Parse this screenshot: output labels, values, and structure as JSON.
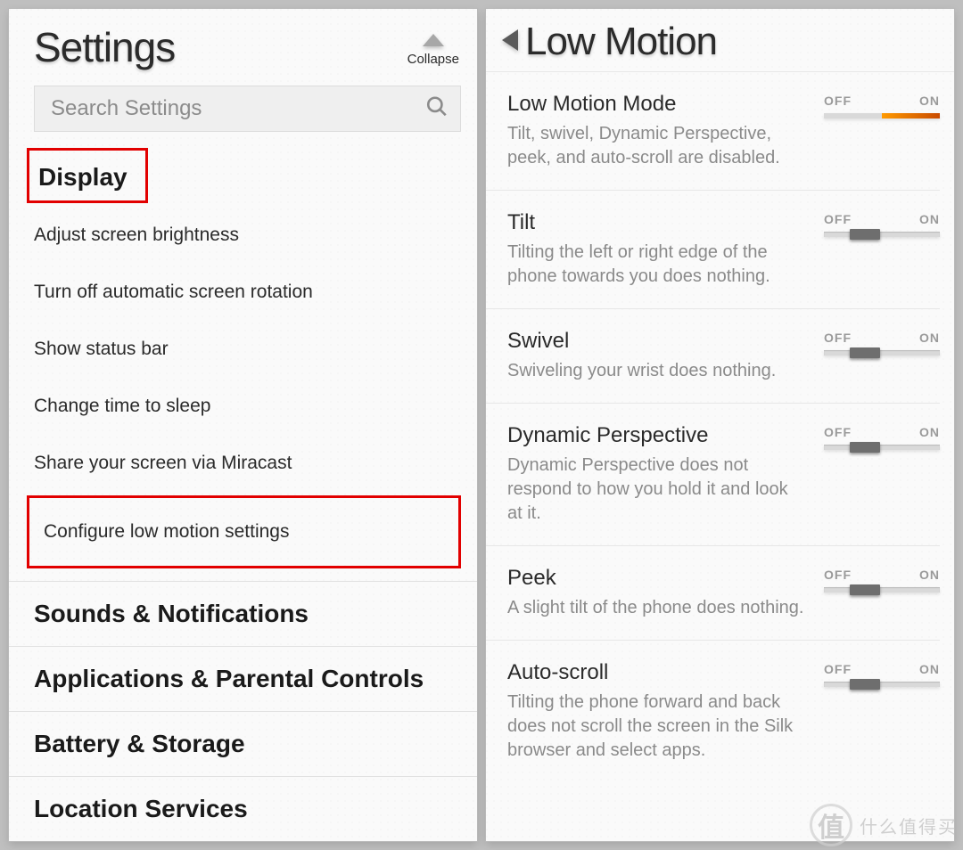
{
  "left": {
    "title": "Settings",
    "collapse_label": "Collapse",
    "search_placeholder": "Search Settings",
    "display": {
      "header": "Display",
      "items": [
        "Adjust screen brightness",
        "Turn off automatic screen rotation",
        "Show status bar",
        "Change time to sleep",
        "Share your screen via Miracast",
        "Configure low motion settings"
      ]
    },
    "categories": [
      "Sounds & Notifications",
      "Applications & Parental Controls",
      "Battery & Storage",
      "Location Services"
    ]
  },
  "right": {
    "title": "Low Motion",
    "toggle_off": "OFF",
    "toggle_on": "ON",
    "rows": [
      {
        "title": "Low Motion Mode",
        "desc": "Tilt, swivel, Dynamic Perspective, peek, and auto-scroll are disabled.",
        "state": "on"
      },
      {
        "title": "Tilt",
        "desc": "Tilting the left or right edge of the phone towards you does nothing.",
        "state": "off"
      },
      {
        "title": "Swivel",
        "desc": "Swiveling your wrist does nothing.",
        "state": "off"
      },
      {
        "title": "Dynamic Perspective",
        "desc": "Dynamic Perspective does not respond to how you hold it and look at it.",
        "state": "off"
      },
      {
        "title": "Peek",
        "desc": "A slight tilt of the phone does nothing.",
        "state": "off"
      },
      {
        "title": "Auto-scroll",
        "desc": "Tilting the phone forward and back does not scroll the screen in the Silk browser and select apps.",
        "state": "off"
      }
    ]
  },
  "watermark": {
    "glyph": "值",
    "text": "什么值得买"
  }
}
